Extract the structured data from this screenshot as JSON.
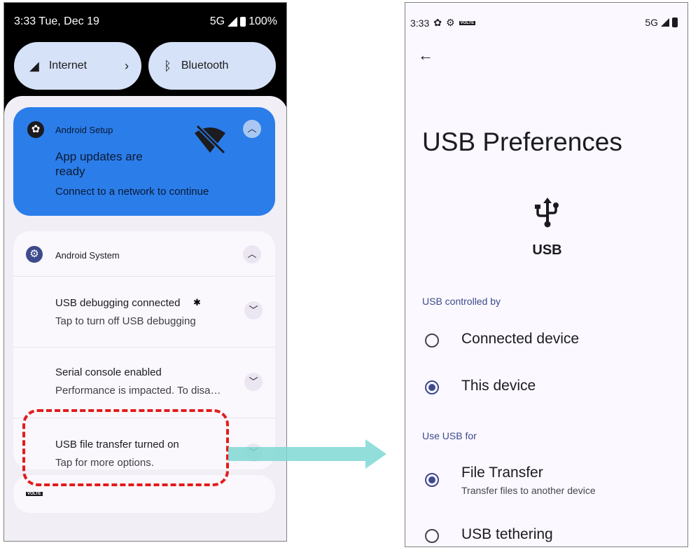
{
  "left_phone": {
    "status": {
      "time_date": "3:33  Tue, Dec 19",
      "network": "5G",
      "battery": "100%"
    },
    "tiles": [
      {
        "label": "Internet",
        "icon": "signal-icon"
      },
      {
        "label": "Bluetooth",
        "icon": "bluetooth-icon"
      }
    ],
    "setup_notification": {
      "app": "Android Setup",
      "title": "App updates are ready",
      "body": "Connect to a network to continue"
    },
    "system_group": {
      "app": "Android System",
      "notifications": [
        {
          "title": "USB debugging connected",
          "body": "Tap to turn off USB debugging"
        },
        {
          "title": "Serial console enabled",
          "body": "Performance is impacted. To disa…"
        },
        {
          "title": "USB file transfer turned on",
          "body": "Tap for more options."
        }
      ]
    },
    "volte_badge": "VOLTE",
    "colors": {
      "highlight": "#e21c1c",
      "arrow": "#7fd8d3",
      "setup_card": "#2b7de9"
    }
  },
  "right_phone": {
    "status": {
      "time": "3:33",
      "network": "5G",
      "volte": "VOLTE"
    },
    "page_title": "USB Preferences",
    "usb_label": "USB",
    "sections": [
      {
        "header": "USB controlled by",
        "options": [
          {
            "label": "Connected device",
            "selected": false
          },
          {
            "label": "This device",
            "selected": true
          }
        ]
      },
      {
        "header": "Use USB for",
        "options": [
          {
            "label": "File Transfer",
            "sub": "Transfer files to another device",
            "selected": true
          },
          {
            "label": "USB tethering",
            "selected": false
          }
        ]
      }
    ],
    "colors": {
      "accent": "#3d4a8c"
    }
  }
}
